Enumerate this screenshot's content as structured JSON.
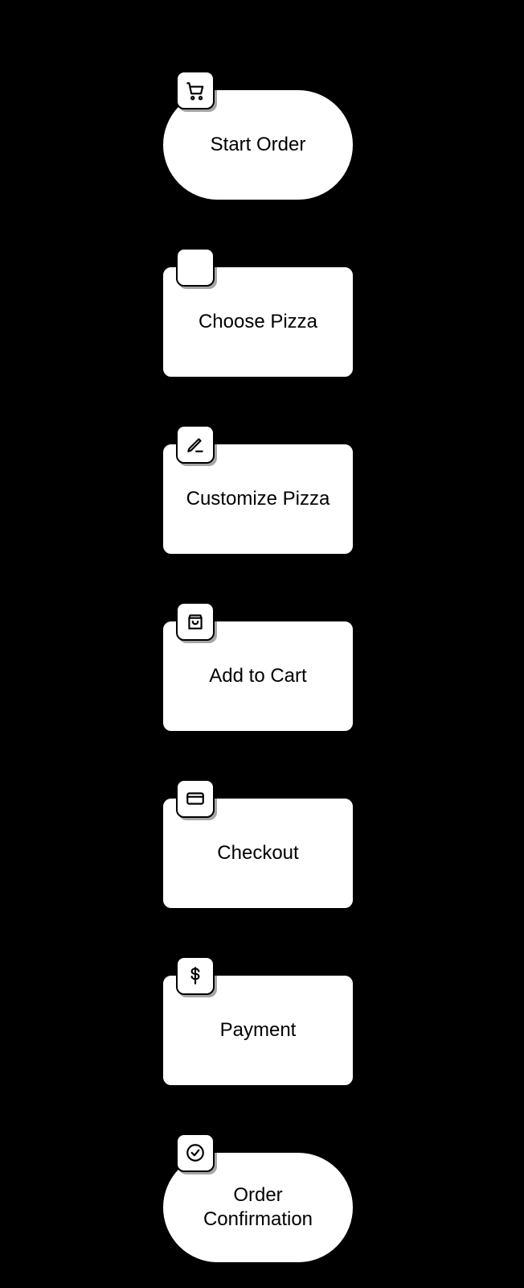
{
  "flow": {
    "nodes": [
      {
        "id": "start-order",
        "label": "Start Order",
        "shape": "terminator",
        "icon": "cart-icon"
      },
      {
        "id": "choose-pizza",
        "label": "Choose Pizza",
        "shape": "process",
        "icon": "blank-icon"
      },
      {
        "id": "customize-pizza",
        "label": "Customize Pizza",
        "shape": "process",
        "icon": "pencil-icon"
      },
      {
        "id": "add-to-cart",
        "label": "Add to Cart",
        "shape": "process",
        "icon": "bag-icon"
      },
      {
        "id": "checkout",
        "label": "Checkout",
        "shape": "process",
        "icon": "card-icon"
      },
      {
        "id": "payment",
        "label": "Payment",
        "shape": "process",
        "icon": "dollar-icon"
      },
      {
        "id": "order-confirmation",
        "label": "Order Confirmation",
        "shape": "terminator",
        "icon": "check-icon"
      }
    ]
  }
}
